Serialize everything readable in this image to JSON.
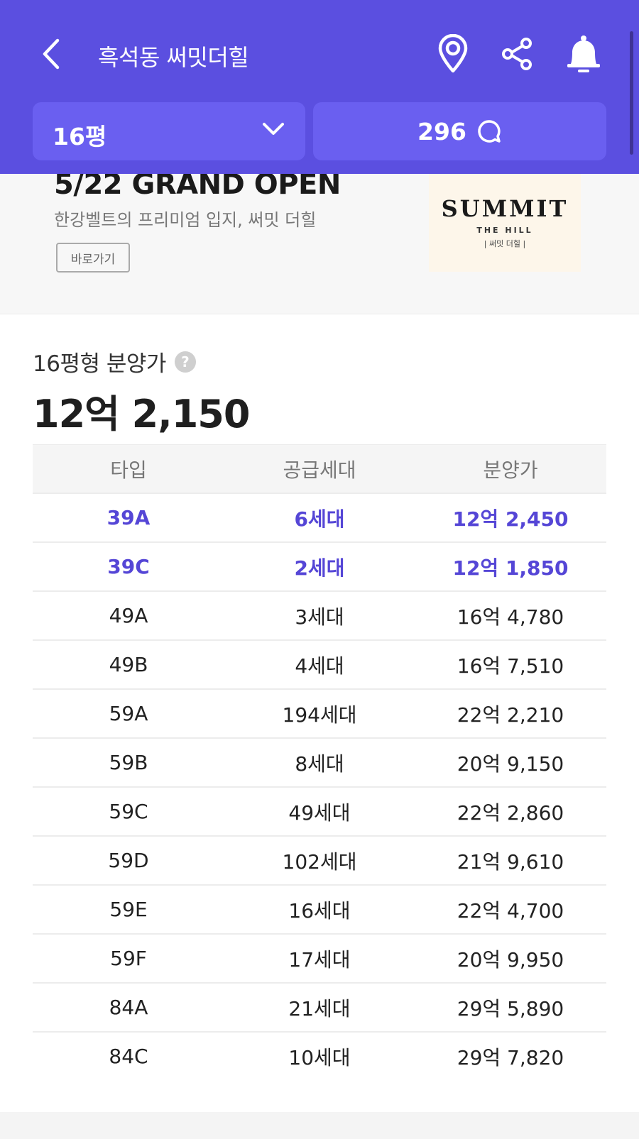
{
  "header": {
    "title": "흑석동 써밋더힐",
    "back_icon": "chevron-left-icon",
    "map_icon": "location-pin-icon",
    "share_icon": "share-icon",
    "bell_icon": "bell-icon",
    "size_select": "16평",
    "comment_count": "296",
    "bg_color": "#5b4fe0"
  },
  "banner": {
    "headline": "5/22 GRAND OPEN",
    "subtext": "한강벨트의 프리미엄 입지, 써밋 더힐",
    "link_label": "바로가기",
    "logo_main": "SUMMIT",
    "logo_sub": "THE HILL",
    "logo_kr": "| 써밋 더힐 |"
  },
  "price": {
    "label": "16평형 분양가",
    "value": "12억 2,150"
  },
  "table": {
    "headers": [
      "타입",
      "공급세대",
      "분양가"
    ],
    "highlight_color": "#5546d6",
    "rows": [
      {
        "type": "39A",
        "units": "6세대",
        "price": "12억 2,450",
        "highlight": true
      },
      {
        "type": "39C",
        "units": "2세대",
        "price": "12억 1,850",
        "highlight": true
      },
      {
        "type": "49A",
        "units": "3세대",
        "price": "16억 4,780",
        "highlight": false
      },
      {
        "type": "49B",
        "units": "4세대",
        "price": "16억 7,510",
        "highlight": false
      },
      {
        "type": "59A",
        "units": "194세대",
        "price": "22억 2,210",
        "highlight": false
      },
      {
        "type": "59B",
        "units": "8세대",
        "price": "20억 9,150",
        "highlight": false
      },
      {
        "type": "59C",
        "units": "49세대",
        "price": "22억 2,860",
        "highlight": false
      },
      {
        "type": "59D",
        "units": "102세대",
        "price": "21억 9,610",
        "highlight": false
      },
      {
        "type": "59E",
        "units": "16세대",
        "price": "22억 4,700",
        "highlight": false
      },
      {
        "type": "59F",
        "units": "17세대",
        "price": "20억 9,950",
        "highlight": false
      },
      {
        "type": "84A",
        "units": "21세대",
        "price": "29억 5,890",
        "highlight": false
      },
      {
        "type": "84C",
        "units": "10세대",
        "price": "29억 7,820",
        "highlight": false
      }
    ]
  }
}
